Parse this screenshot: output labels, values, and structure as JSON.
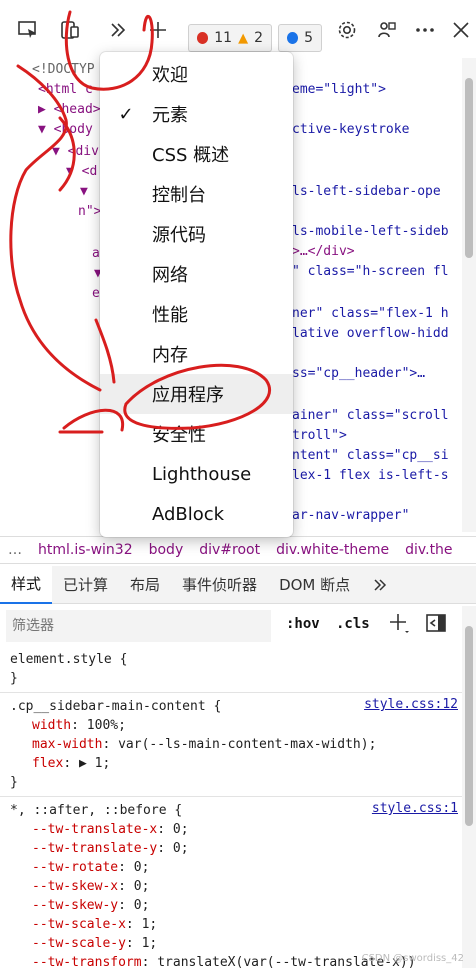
{
  "toolbar": {
    "errors_count": "11",
    "warnings_count": "2",
    "messages_count": "5",
    "colors": {
      "error": "#d93025",
      "warning": "#f29900",
      "message": "#1a73e8"
    }
  },
  "tree_lines": [
    {
      "indent": "",
      "text": "<!DOCTYP"
    },
    {
      "indent": "",
      "text": "<html c"
    },
    {
      "indent": "",
      "text": "▶ <head>"
    },
    {
      "indent": "",
      "text": "▼ <body"
    },
    {
      "indent": "",
      "text": "▼ <div"
    },
    {
      "indent": "",
      "text": "▼ <d"
    },
    {
      "indent": "",
      "text": "▼"
    },
    {
      "indent": "",
      "text": "n\">"
    },
    {
      "indent": "",
      "text": ""
    },
    {
      "indent": "",
      "text": "a"
    },
    {
      "indent": "",
      "text": "▼"
    },
    {
      "indent": "",
      "text": "e"
    }
  ],
  "tree_right": [
    "eme=\"light\">",
    "",
    "ctive-keystroke",
    "",
    "",
    "ls-left-sidebar-ope",
    "",
    "ls-mobile-left-sideb",
    ">…</div>",
    "\" class=\"h-screen fl",
    "",
    "ner\" class=\"flex-1 h",
    "lative overflow-hidd",
    "",
    "ss=\"cp__header\">…",
    "",
    "ainer\" class=\"scroll",
    "troll\">",
    "ntent\" class=\"cp__si",
    "lex-1 flex is-left-s",
    "",
    "ar-nav-wrapper\""
  ],
  "breadcrumbs": [
    "html.is-win32",
    "body",
    "div#root",
    "div.white-theme",
    "div.the"
  ],
  "tabs": [
    "样式",
    "已计算",
    "布局",
    "事件侦听器",
    "DOM 断点"
  ],
  "filter": {
    "placeholder": "筛选器",
    "hov": ":hov",
    "cls": ".cls"
  },
  "rules": {
    "element_style": {
      "selector": "element.style {",
      "close": "}"
    },
    "sidebar": {
      "selector": ".cp__sidebar-main-content {",
      "source": "style.css:12",
      "props": [
        {
          "name": "width",
          "value": "100%;"
        },
        {
          "name": "max-width",
          "value": "var(--ls-main-content-max-width);"
        },
        {
          "name": "flex",
          "value": "▶ 1;"
        }
      ],
      "close": "}"
    },
    "universal": {
      "selector": "*, ::after, ::before {",
      "source": "style.css:1",
      "props": [
        {
          "name": "--tw-translate-x",
          "value": "0;"
        },
        {
          "name": "--tw-translate-y",
          "value": "0;"
        },
        {
          "name": "--tw-rotate",
          "value": "0;"
        },
        {
          "name": "--tw-skew-x",
          "value": "0;"
        },
        {
          "name": "--tw-skew-y",
          "value": "0;"
        },
        {
          "name": "--tw-scale-x",
          "value": "1;"
        },
        {
          "name": "--tw-scale-y",
          "value": "1;"
        },
        {
          "name": "--tw-transform",
          "value": "translateX(var(--tw-translate-x))"
        }
      ]
    }
  },
  "menu": {
    "items": [
      {
        "label": "欢迎",
        "checked": false
      },
      {
        "label": "元素",
        "checked": true
      },
      {
        "label": "CSS 概述",
        "checked": false
      },
      {
        "label": "控制台",
        "checked": false
      },
      {
        "label": "源代码",
        "checked": false
      },
      {
        "label": "网络",
        "checked": false
      },
      {
        "label": "性能",
        "checked": false
      },
      {
        "label": "内存",
        "checked": false
      },
      {
        "label": "应用程序",
        "checked": false
      },
      {
        "label": "安全性",
        "checked": false
      },
      {
        "label": "Lighthouse",
        "checked": false
      },
      {
        "label": "AdBlock",
        "checked": false
      }
    ],
    "check_glyph": "✓"
  },
  "watermark": "CSDN @swordiss_42",
  "annotation_color": "#d81e1e"
}
